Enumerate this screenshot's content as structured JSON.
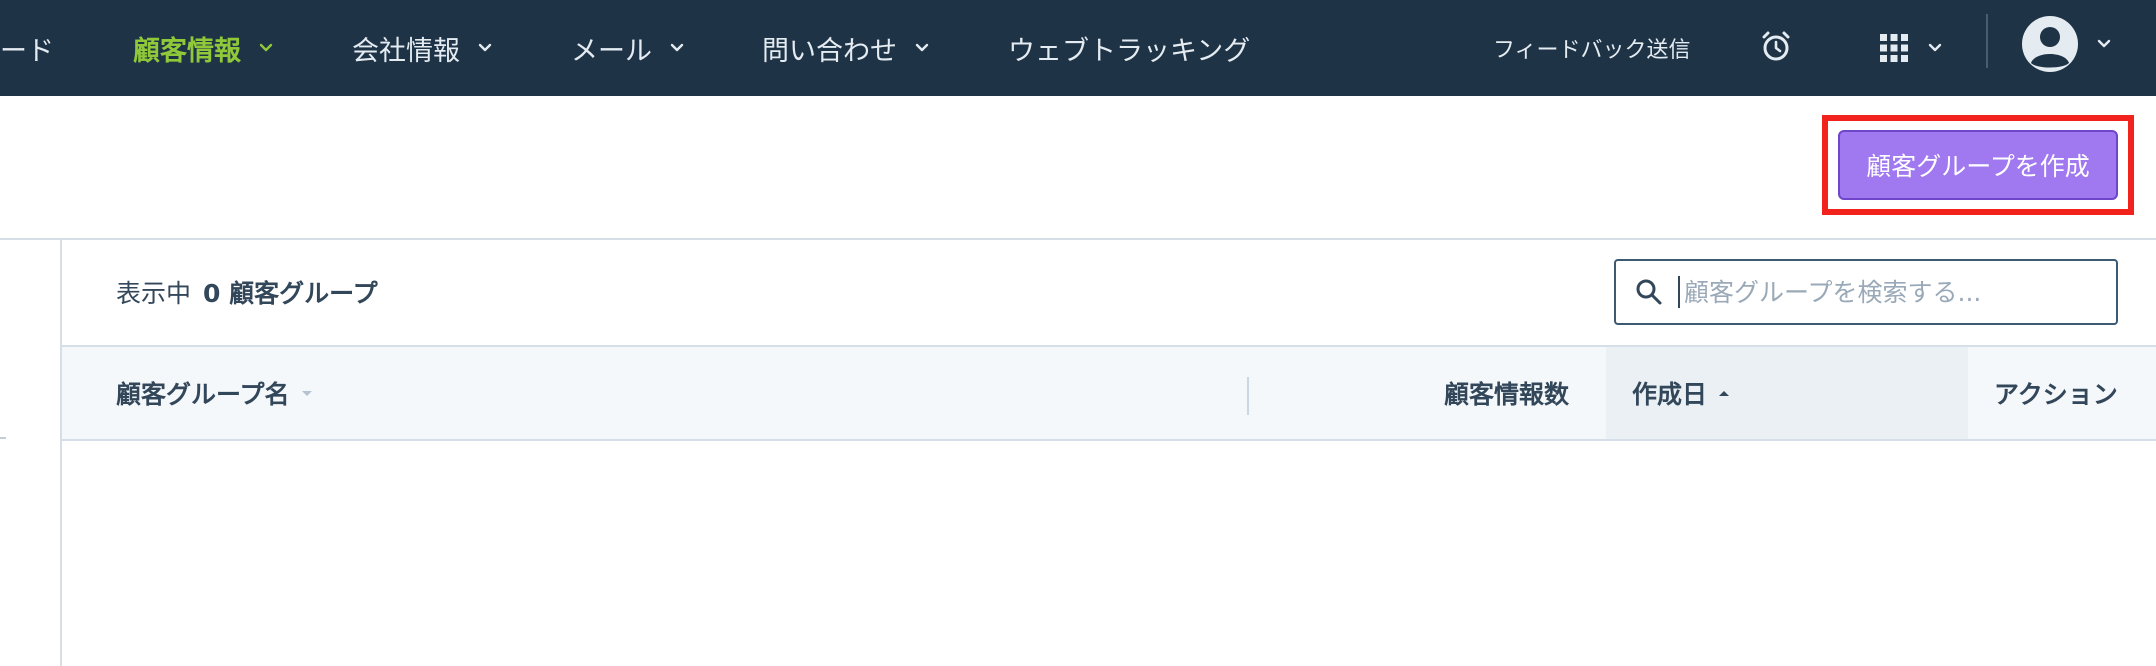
{
  "topnav": {
    "items": [
      {
        "label": "ード",
        "active": false,
        "has_dropdown": false
      },
      {
        "label": "顧客情報",
        "active": true,
        "has_dropdown": true
      },
      {
        "label": "会社情報",
        "active": false,
        "has_dropdown": true
      },
      {
        "label": "メール",
        "active": false,
        "has_dropdown": true
      },
      {
        "label": "問い合わせ",
        "active": false,
        "has_dropdown": true
      },
      {
        "label": "ウェブトラッキング",
        "active": false,
        "has_dropdown": false
      }
    ],
    "feedback_label": "フィードバック送信",
    "icons": [
      "alarm-clock-icon",
      "apps-grid-icon",
      "user-avatar-icon"
    ],
    "colors": {
      "background": "#1f3346",
      "active": "#8fc93a",
      "text": "#e4ebf1"
    }
  },
  "header": {
    "create_button_label": "顧客グループを作成",
    "create_button_color": "#a078f0",
    "highlight_color": "#f2231c"
  },
  "toolbar": {
    "showing_prefix": "表示中",
    "showing_count": "0 顧客グループ",
    "search_placeholder": "顧客グループを検索する..."
  },
  "table": {
    "columns": [
      {
        "label": "顧客グループ名",
        "sort": "none"
      },
      {
        "label": "顧客情報数",
        "sort": "none"
      },
      {
        "label": "作成日",
        "sort": "asc"
      },
      {
        "label": "アクション",
        "sort": "none"
      }
    ],
    "rows": []
  }
}
